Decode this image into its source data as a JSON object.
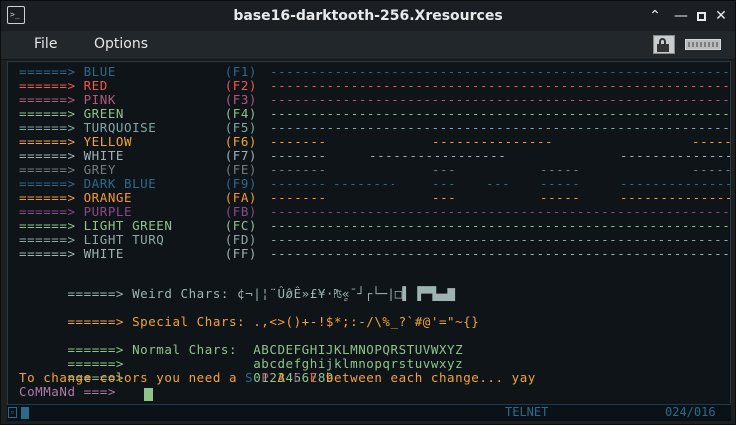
{
  "window": {
    "title": "base16-darktooth-256.Xresources",
    "app_icon_text": ">_"
  },
  "menubar": {
    "file": "File",
    "options": "Options"
  },
  "colors": {
    "blue": "#2c6a8a",
    "red": "#f0584a",
    "pink": "#b0597e",
    "green": "#8fc38a",
    "turquoise": "#7fa8a6",
    "yellow": "#f3a33a",
    "white": "#9fb3b3",
    "grey": "#737c7f",
    "purple": "#8a4a8a",
    "orange": "#f79a2e",
    "background": "#0f1419",
    "title_bar": "#1b1f23"
  },
  "color_rows": [
    {
      "arrow": "======>",
      "label": "BLUE",
      "key": "(F1)",
      "cls": "c-blue"
    },
    {
      "arrow": "======>",
      "label": "RED",
      "key": "(F2)",
      "cls": "c-red"
    },
    {
      "arrow": "======>",
      "label": "PINK",
      "key": "(F3)",
      "cls": "c-pink"
    },
    {
      "arrow": "======>",
      "label": "GREEN",
      "key": "(F4)",
      "cls": "c-green"
    },
    {
      "arrow": "======>",
      "label": "TURQUOISE",
      "key": "(F5)",
      "cls": "c-turq"
    },
    {
      "arrow": "======>",
      "label": "YELLOW",
      "key": "(F6)",
      "cls": "c-yellow"
    },
    {
      "arrow": "======>",
      "label": "WHITE",
      "key": "(F7)",
      "cls": "c-white"
    },
    {
      "arrow": "======>",
      "label": "GREY",
      "key": "(FE)",
      "cls": "c-grey"
    },
    {
      "arrow": "======>",
      "label": "DARK BLUE",
      "key": "(F9)",
      "cls": "c-blue"
    },
    {
      "arrow": "======>",
      "label": "ORANGE",
      "key": "(FA)",
      "cls": "c-orange"
    },
    {
      "arrow": "======>",
      "label": "PURPLE",
      "key": "(FB)",
      "cls": "c-purple"
    },
    {
      "arrow": "======>",
      "label": "LIGHT GREEN",
      "key": "(FC)",
      "cls": "c-lgreen"
    },
    {
      "arrow": "======>",
      "label": "LIGHT TURQ",
      "key": "(FD)",
      "cls": "c-lturq"
    },
    {
      "arrow": "======>",
      "label": "WHITE",
      "key": "(FF)",
      "cls": "c-white"
    }
  ],
  "weird": {
    "arrow": "======>",
    "text": "Weird Chars: ¢¬|¦¨Ûø̂Ê»£¥·₧«ٍˉ┘┌└─|□▌ ▛▀▙▄▇"
  },
  "special": {
    "arrow": "======>",
    "text": "Special Chars: .,<>()+-!$*;:-/\\%_?`#@'=\"~{}"
  },
  "normal": {
    "arrow": "======>",
    "label": "Normal Chars:",
    "upper": "ABCDEFGHIJKLMNOPQRSTUVWXYZ",
    "lower": "abcdefghijklmnopqrstuvwxyz",
    "digits": "0123456789"
  },
  "instruction": {
    "before": "To change colors you need a ",
    "s": "S",
    "p": "P",
    "a": "A",
    "c": "C",
    "e": "E",
    "after": " between each change... yay"
  },
  "prompt": {
    "text": "CoMMaNd ===>"
  },
  "status": {
    "mode": "TELNET",
    "position": "024/016"
  }
}
